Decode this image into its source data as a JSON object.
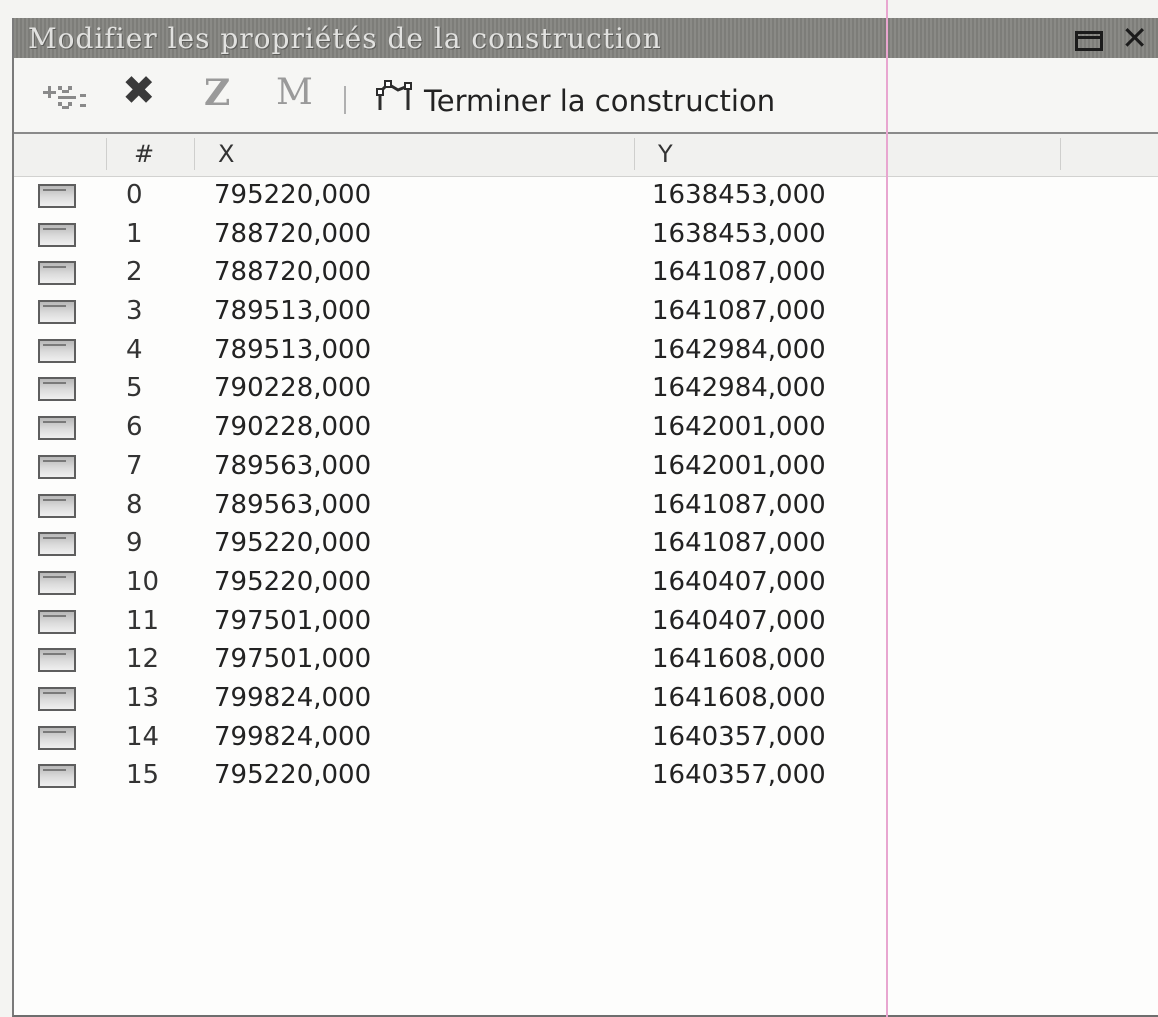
{
  "window": {
    "title": "Modifier les propriétés de la construction"
  },
  "toolbar": {
    "icons": [
      "add-vertex-icon",
      "delete-icon",
      "z-label",
      "m-label",
      "finish-construction-icon"
    ],
    "z_label": "Z",
    "m_label": "M",
    "separator": "|",
    "finish_label": "Terminer la construction"
  },
  "grid": {
    "headers": {
      "index": "#",
      "x": "X",
      "y": "Y"
    },
    "rows": [
      {
        "index": "0",
        "x": "795220,000",
        "y": "1638453,000"
      },
      {
        "index": "1",
        "x": "788720,000",
        "y": "1638453,000"
      },
      {
        "index": "2",
        "x": "788720,000",
        "y": "1641087,000"
      },
      {
        "index": "3",
        "x": "789513,000",
        "y": "1641087,000"
      },
      {
        "index": "4",
        "x": "789513,000",
        "y": "1642984,000"
      },
      {
        "index": "5",
        "x": "790228,000",
        "y": "1642984,000"
      },
      {
        "index": "6",
        "x": "790228,000",
        "y": "1642001,000"
      },
      {
        "index": "7",
        "x": "789563,000",
        "y": "1642001,000"
      },
      {
        "index": "8",
        "x": "789563,000",
        "y": "1641087,000"
      },
      {
        "index": "9",
        "x": "795220,000",
        "y": "1641087,000"
      },
      {
        "index": "10",
        "x": "795220,000",
        "y": "1640407,000"
      },
      {
        "index": "11",
        "x": "797501,000",
        "y": "1640407,000"
      },
      {
        "index": "12",
        "x": "797501,000",
        "y": "1641608,000"
      },
      {
        "index": "13",
        "x": "799824,000",
        "y": "1641608,000"
      },
      {
        "index": "14",
        "x": "799824,000",
        "y": "1640357,000"
      },
      {
        "index": "15",
        "x": "795220,000",
        "y": "1640357,000"
      }
    ]
  }
}
